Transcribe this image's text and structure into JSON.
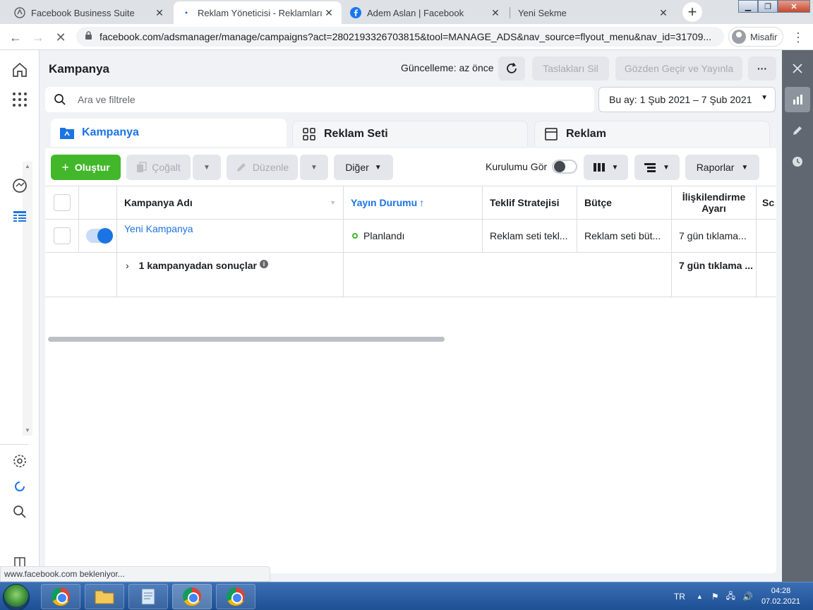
{
  "browser": {
    "tabs": [
      {
        "title": "Facebook Business Suite",
        "active": false
      },
      {
        "title": "Reklam Yöneticisi - Reklamları Yö",
        "active": true
      },
      {
        "title": "Adem Aslan | Facebook",
        "active": false
      },
      {
        "title": "Yeni Sekme",
        "active": false
      }
    ],
    "url": "facebook.com/adsmanager/manage/campaigns?act=2802193326703815&tool=MANAGE_ADS&nav_source=flyout_menu&nav_id=31709...",
    "profile_label": "Misafir",
    "status_text": "www.facebook.com bekleniyor..."
  },
  "header": {
    "title": "Kampanya",
    "updated": "Güncelleme: az önce",
    "delete_drafts": "Taslakları Sil",
    "review_publish": "Gözden Geçir ve Yayınla",
    "more": "···"
  },
  "search": {
    "placeholder": "Ara ve filtrele"
  },
  "date_range": "Bu ay: 1 Şub 2021 – 7 Şub 2021",
  "level_tabs": [
    {
      "label": "Kampanya"
    },
    {
      "label": "Reklam Seti"
    },
    {
      "label": "Reklam"
    }
  ],
  "toolbar": {
    "create": "Oluştur",
    "duplicate": "Çoğalt",
    "edit": "Düzenle",
    "other": "Diğer",
    "setup_label": "Kurulumu Gör",
    "reports": "Raporlar"
  },
  "table": {
    "columns": [
      "Kampanya Adı",
      "Yayın Durumu",
      "Teklif Stratejisi",
      "Bütçe",
      "İlişkilendirme Ayarı",
      "Sc"
    ],
    "rows": [
      {
        "name": "Yeni Kampanya",
        "status": "Planlandı",
        "bid": "Reklam seti tekl...",
        "budget": "Reklam seti büt...",
        "attribution": "7 gün tıklama..."
      }
    ],
    "summary": {
      "label": "1 kampanyadan sonuçlar",
      "attribution": "7 gün tıklama ..."
    }
  },
  "taskbar": {
    "lang": "TR",
    "time": "04:28",
    "date": "07.02.2021"
  },
  "colors": {
    "accent": "#1b74e4",
    "create": "#42b72a",
    "status_dot": "#42b72a"
  }
}
